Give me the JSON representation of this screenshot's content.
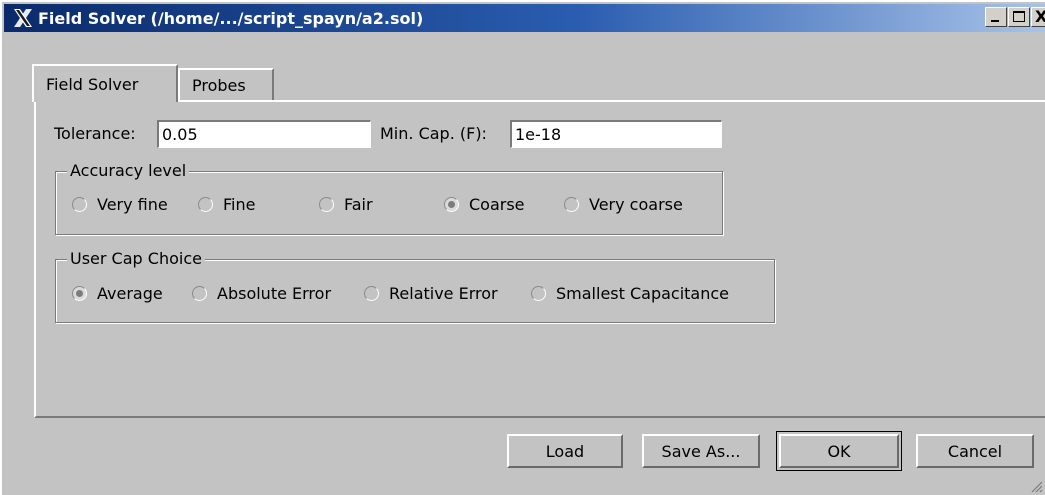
{
  "window": {
    "title": "Field Solver (/home/.../script_spayn/a2.sol)",
    "controls": {
      "minimize": "_",
      "maximize": "□",
      "close": "X"
    }
  },
  "tabs": [
    {
      "label": "Field Solver",
      "active": true
    },
    {
      "label": "Probes",
      "active": false
    }
  ],
  "tolerance": {
    "label": "Tolerance:",
    "value": "0.05"
  },
  "min_cap": {
    "label": "Min. Cap. (F):",
    "value": "1e-18"
  },
  "accuracy": {
    "legend": "Accuracy level",
    "options": [
      {
        "label": "Very fine",
        "checked": false
      },
      {
        "label": "Fine",
        "checked": false
      },
      {
        "label": "Fair",
        "checked": false
      },
      {
        "label": "Coarse",
        "checked": true
      },
      {
        "label": "Very coarse",
        "checked": false
      }
    ]
  },
  "user_cap": {
    "legend": "User Cap Choice",
    "options": [
      {
        "label": "Average",
        "checked": true
      },
      {
        "label": "Absolute Error",
        "checked": false
      },
      {
        "label": "Relative Error",
        "checked": false
      },
      {
        "label": "Smallest Capacitance",
        "checked": false
      }
    ]
  },
  "buttons": {
    "load": "Load",
    "save_as": "Save As...",
    "ok": "OK",
    "cancel": "Cancel"
  }
}
